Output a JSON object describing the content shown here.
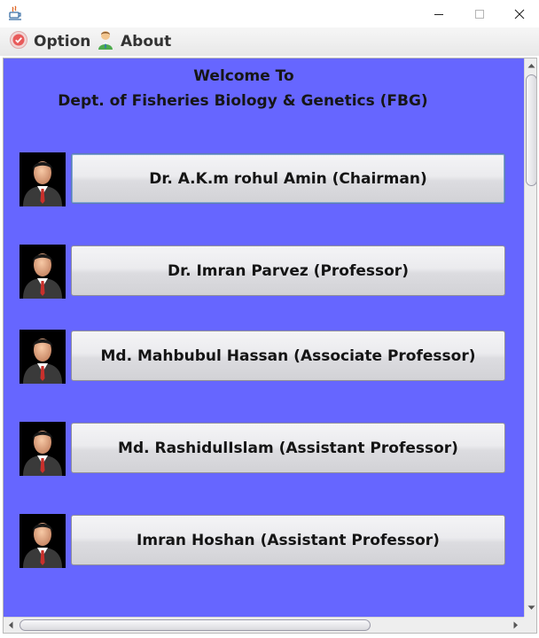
{
  "window": {
    "title": "",
    "controls": [
      "minimize",
      "maximize",
      "close"
    ]
  },
  "menubar": {
    "items": [
      {
        "label": "Option",
        "icon": "option-icon"
      },
      {
        "label": "About",
        "icon": "person-icon"
      }
    ]
  },
  "content": {
    "background": "#6666ff",
    "welcome_line1": "Welcome To",
    "welcome_line2": "Dept. of Fisheries Biology & Genetics (FBG)",
    "faculty": [
      {
        "label": "Dr. A.K.m rohul Amin (Chairman)",
        "icon": "businessman-avatar-icon",
        "focused": true
      },
      {
        "label": "Dr. Imran Parvez (Professor)",
        "icon": "businessman-avatar-icon",
        "focused": false
      },
      {
        "label": "Md. Mahbubul Hassan (Associate Professor)",
        "icon": "businessman-avatar-icon",
        "focused": false
      },
      {
        "label": "Md. RashidulIslam (Assistant Professor)",
        "icon": "businessman-avatar-icon",
        "focused": false
      },
      {
        "label": "Imran Hoshan (Assistant Professor)",
        "icon": "businessman-avatar-icon",
        "focused": false
      }
    ]
  },
  "scrollbars": {
    "vertical": {
      "position": 0.0
    },
    "horizontal": {
      "position": 0.0
    }
  }
}
